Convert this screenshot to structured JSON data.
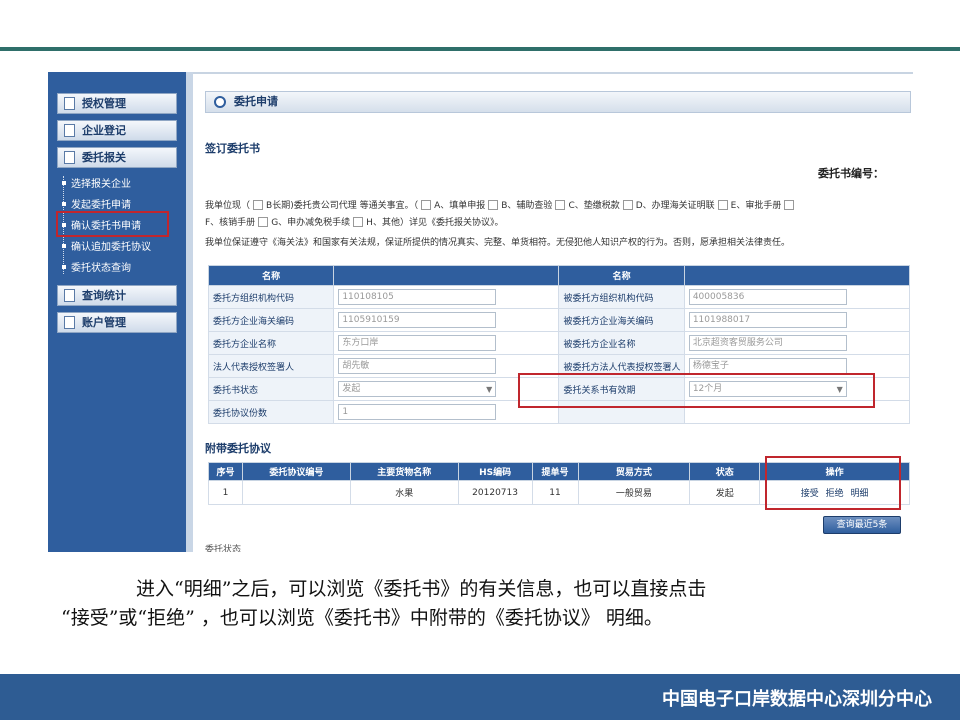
{
  "sidebar": {
    "heads": [
      {
        "label": "授权管理"
      },
      {
        "label": "企业登记"
      },
      {
        "label": "委托报关"
      },
      {
        "label": "查询统计"
      },
      {
        "label": "账户管理"
      }
    ],
    "subitems": [
      {
        "label": "选择报关企业"
      },
      {
        "label": "发起委托申请"
      },
      {
        "label": "确认委托书申请"
      },
      {
        "label": "确认追加委托协议"
      },
      {
        "label": "委托状态查询"
      }
    ]
  },
  "main": {
    "title": "委托申请",
    "section1": "签订委托书",
    "entrust_no_label": "委托书编号：",
    "statement": {
      "p1": "我单位现（",
      "p2": "B长期)委托贵公司代理 等通关事宜。（",
      "opts": [
        "A、填单申报",
        "B、辅助查验",
        "C、垫缴税款",
        "D、办理海关证明联",
        "E、审批手册",
        "F、核销手册",
        "G、申办减免税手续",
        "H、其他"
      ],
      "p3": "）详见《委托报关协议》。",
      "line3": "我单位保证遵守《海关法》和国家有关法规，保证所提供的情况真实、完整、单货相符。无侵犯他人知识产权的行为。否则，愿承担相关法律责任。"
    },
    "form": {
      "headers": [
        "名称",
        "",
        "名称",
        ""
      ],
      "rows": [
        {
          "l1": "委托方组织机构代码",
          "v1": "110108105",
          "l2": "被委托方组织机构代码",
          "v2": "400005836"
        },
        {
          "l1": "委托方企业海关编码",
          "v1": "1105910159",
          "l2": "被委托方企业海关编码",
          "v2": "1101988017"
        },
        {
          "l1": "委托方企业名称",
          "v1": "东方口岸",
          "l2": "被委托方企业名称",
          "v2": "北京超资客贸服务公司"
        },
        {
          "l1": "法人代表授权签署人",
          "v1": "胡先敏",
          "l2": "被委托方法人代表授权签署人",
          "v2": "杨德宝子"
        },
        {
          "l1": "委托书状态",
          "v1": "发起",
          "l2": "委托关系书有效期",
          "v2": "12个月"
        },
        {
          "l1": "委托协议份数",
          "v1": "1"
        }
      ]
    },
    "section2": "附带委托协议",
    "attach": {
      "headers": [
        "序号",
        "委托协议编号",
        "主要货物名称",
        "HS编码",
        "提单号",
        "贸易方式",
        "状态",
        "操作"
      ],
      "row": {
        "no": "1",
        "agree_no": "",
        "goods": "水果",
        "hs": "20120713",
        "bill": "11",
        "trade": "一般贸易",
        "status": "发起"
      },
      "ops": [
        "接受",
        "拒绝",
        "明细"
      ]
    },
    "query_button": "查询最近5条",
    "cutoff_text": "委托状态"
  },
  "caption": {
    "line1": "进入“明细”之后，可以浏览《委托书》的有关信息，也可以直接点击",
    "line2": "“接受”或“拒绝” ，也可以浏览《委托书》中附带的《委托协议》 明细。"
  },
  "footer": {
    "org": "中国电子口岸数据中心深圳分中心"
  },
  "colors": {
    "sidebar": "#2f5e9e",
    "table_header": "#2f5e9e",
    "highlight": "#c0262d",
    "footer": "#2e5c93",
    "top_rule": "#2f6f6a"
  }
}
